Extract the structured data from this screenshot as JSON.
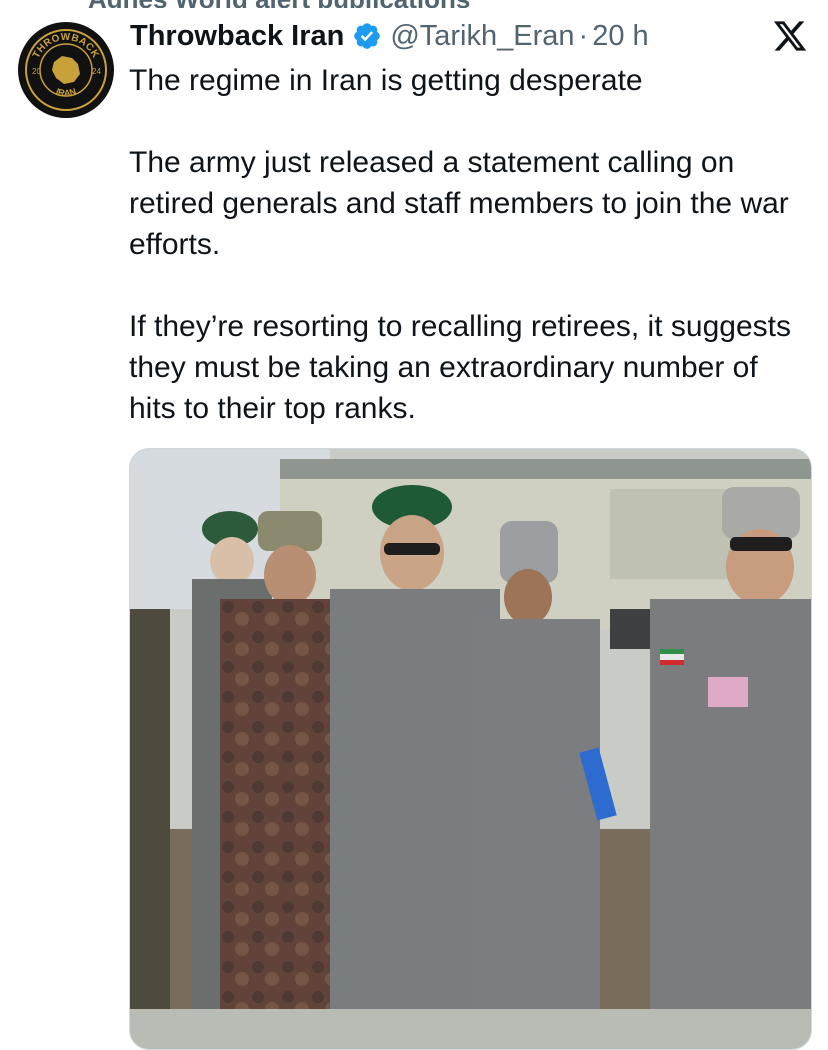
{
  "context_line": {
    "text": "Agnes World alert publications"
  },
  "tweet": {
    "display_name": "Throwback Iran",
    "handle": "@Tarikh_Eran",
    "separator": "·",
    "time": "20 h",
    "paragraphs": [
      "The regime in Iran is getting desperate",
      "The army just released a statement calling on retired generals and staff members to join the war efforts.",
      "If they’re resorting to recalling retirees, it suggests they must be taking an extraordinary number of hits to their top ranks."
    ]
  },
  "avatar": {
    "top_text": "THROWBACK",
    "bottom_text": "IRAN",
    "left_year": "20",
    "right_year": "24",
    "ring_color": "#c9a13b",
    "background_color": "#111111"
  },
  "icons": {
    "verified": "verified-badge-icon",
    "platform": "x-logo-icon"
  },
  "colors": {
    "text_primary": "#0f1419",
    "text_secondary": "#536471",
    "verified_blue": "#1d9bf0"
  },
  "media": {
    "description_icon": "photo-military-officers"
  }
}
